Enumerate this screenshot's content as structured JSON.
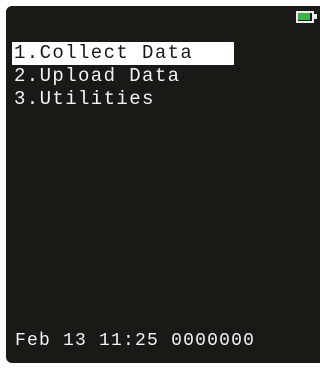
{
  "status_bar": {
    "battery_icon": "battery-icon",
    "battery_color": "#3ab34a"
  },
  "menu": {
    "items": [
      {
        "label": "1.Collect Data",
        "selected": true
      },
      {
        "label": "2.Upload Data",
        "selected": false
      },
      {
        "label": "3.Utilities",
        "selected": false
      }
    ]
  },
  "footer": {
    "date": "Feb 13",
    "time": "11:25",
    "id": "0000000"
  },
  "colors": {
    "screen_bg": "#1b1916",
    "text": "#f2f2f2",
    "highlight_bg": "#ffffff"
  }
}
